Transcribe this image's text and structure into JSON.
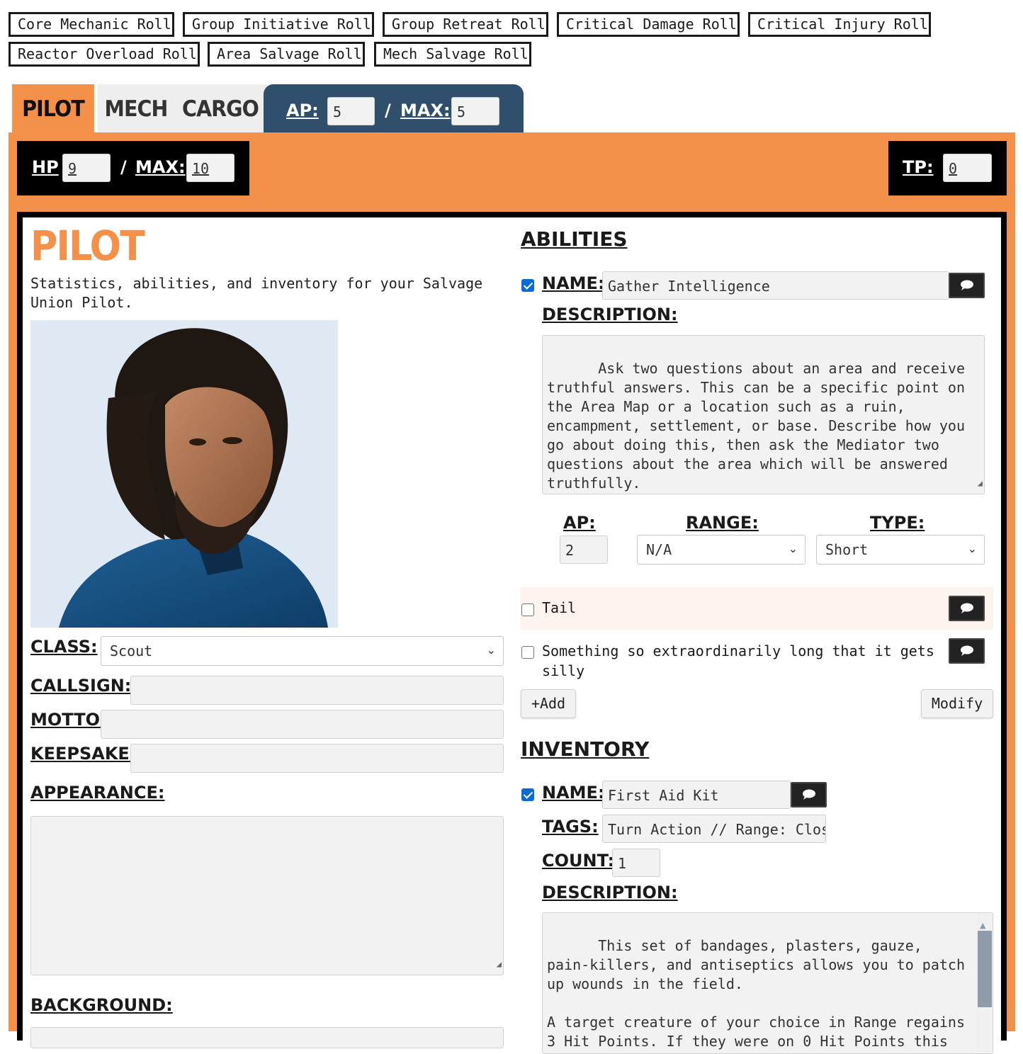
{
  "rolls": [
    "Core Mechanic Roll",
    "Group Initiative Roll",
    "Group Retreat Roll",
    "Critical Damage Roll",
    "Critical Injury Roll",
    "Reactor Overload Roll",
    "Area Salvage Roll",
    "Mech Salvage Roll"
  ],
  "tabs": {
    "pilot": "PILOT",
    "mech": "MECH",
    "cargo": "CARGO"
  },
  "ap": {
    "label": "AP:",
    "value": "5",
    "max_label": "MAX:",
    "max_value": "5",
    "slash": "/"
  },
  "hp": {
    "label": "HP",
    "value": "9",
    "max_label": "MAX:",
    "max_value": "10",
    "slash": "/"
  },
  "tp": {
    "label": "TP:",
    "value": "0"
  },
  "pilot": {
    "title": "PILOT",
    "description": "Statistics, abilities, and inventory for your Salvage Union Pilot.",
    "class_label": "CLASS:",
    "class_value": "Scout",
    "callsign_label": "CALLSIGN:",
    "callsign_value": "",
    "motto_label": "MOTTO:",
    "motto_value": "",
    "keepsake_label": "KEEPSAKE:",
    "keepsake_value": "",
    "appearance_label": "APPEARANCE:",
    "appearance_value": "",
    "background_label": "BACKGROUND:"
  },
  "abilities": {
    "title": "ABILITIES",
    "name_label": "NAME:",
    "name_value": "Gather Intelligence",
    "description_label": "DESCRIPTION:",
    "description_value": "Ask two questions about an area and receive truthful answers. This can be a specific point on the Area Map or a location such as a ruin, encampment, settlement, or base. Describe how you go about doing this, then ask the Mediator two questions about the area which will be answered truthfully.",
    "ap_label": "AP:",
    "ap_value": "2",
    "range_label": "RANGE:",
    "range_value": "N/A",
    "type_label": "TYPE:",
    "type_value": "Short",
    "items": [
      "Tail",
      "Something so extraordinarily long that it gets silly"
    ],
    "add_label": "+Add",
    "modify_label": "Modify"
  },
  "inventory": {
    "title": "INVENTORY",
    "name_label": "NAME:",
    "name_value": "First Aid Kit",
    "tags_label": "TAGS:",
    "tags_value": "Turn Action // Range: Clos",
    "count_label": "COUNT:",
    "count_value": "1",
    "description_label": "DESCRIPTION:",
    "description_value": "This set of bandages, plasters, gauze, pain-killers, and antiseptics allows you to patch up wounds in the field.\n\nA target creature of your choice in Range regains 3 Hit Points. If they were on 0 Hit Points this"
  },
  "colors": {
    "accent": "#f39049",
    "ap_panel": "#2f4f6d",
    "checkbox": "#0b6bd3"
  }
}
